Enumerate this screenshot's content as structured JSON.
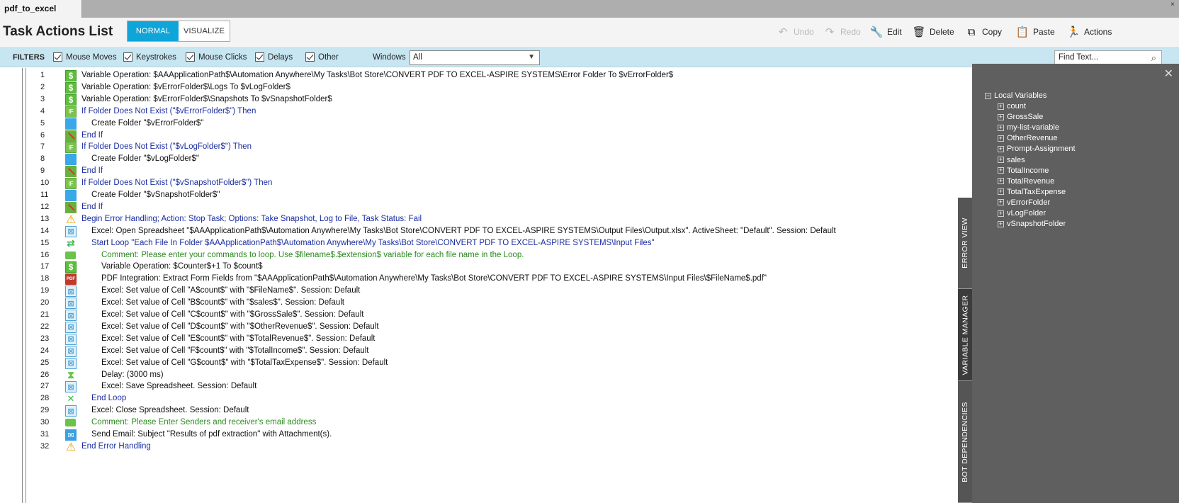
{
  "tab": {
    "label": "pdf_to_excel",
    "close": "×"
  },
  "header": {
    "title": "Task Actions List",
    "modes": {
      "normal": "NORMAL",
      "visualize": "VISUALIZE"
    },
    "toolbar": {
      "undo": "Undo",
      "redo": "Redo",
      "edit": "Edit",
      "delete": "Delete",
      "copy": "Copy",
      "paste": "Paste",
      "actions": "Actions"
    }
  },
  "filters": {
    "label": "FILTERS",
    "items": [
      "Mouse Moves",
      "Keystrokes",
      "Mouse Clicks",
      "Delays",
      "Other"
    ],
    "windows_label": "Windows",
    "windows_value": "All",
    "find_placeholder": "Find Text..."
  },
  "actions": [
    {
      "n": "1",
      "icon": "variable",
      "color": "normal",
      "indent": 0,
      "text": "Variable Operation: $AAApplicationPath$\\Automation Anywhere\\My Tasks\\Bot Store\\CONVERT PDF TO EXCEL-ASPIRE SYSTEMS\\Error Folder To $vErrorFolder$"
    },
    {
      "n": "2",
      "icon": "variable",
      "color": "normal",
      "indent": 0,
      "text": "Variable Operation: $vErrorFolder$\\Logs To $vLogFolder$"
    },
    {
      "n": "3",
      "icon": "variable",
      "color": "normal",
      "indent": 0,
      "text": "Variable Operation: $vErrorFolder$\\Snapshots To $vSnapshotFolder$"
    },
    {
      "n": "4",
      "icon": "if",
      "color": "blue",
      "indent": 0,
      "text": "If Folder Does Not Exist (\"$vErrorFolder$\")  Then"
    },
    {
      "n": "5",
      "icon": "folder",
      "color": "normal",
      "indent": 1,
      "text": "Create Folder \"$vErrorFolder$\""
    },
    {
      "n": "6",
      "icon": "endif",
      "color": "blue",
      "indent": 0,
      "text": "End If"
    },
    {
      "n": "7",
      "icon": "if",
      "color": "blue",
      "indent": 0,
      "text": "If Folder Does Not Exist (\"$vLogFolder$\")  Then"
    },
    {
      "n": "8",
      "icon": "folder",
      "color": "normal",
      "indent": 1,
      "text": "Create Folder \"$vLogFolder$\""
    },
    {
      "n": "9",
      "icon": "endif",
      "color": "blue",
      "indent": 0,
      "text": "End If"
    },
    {
      "n": "10",
      "icon": "if",
      "color": "blue",
      "indent": 0,
      "text": "If Folder Does Not Exist (\"$vSnapshotFolder$\")  Then"
    },
    {
      "n": "11",
      "icon": "folder",
      "color": "normal",
      "indent": 1,
      "text": "Create Folder \"$vSnapshotFolder$\""
    },
    {
      "n": "12",
      "icon": "endif",
      "color": "blue",
      "indent": 0,
      "text": "End If"
    },
    {
      "n": "13",
      "icon": "warning",
      "color": "blue",
      "indent": 0,
      "text": "Begin Error Handling; Action: Stop Task; Options: Take Snapshot, Log to File,  Task Status: Fail"
    },
    {
      "n": "14",
      "icon": "excel",
      "color": "normal",
      "indent": 1,
      "text": "Excel: Open Spreadsheet \"$AAApplicationPath$\\Automation Anywhere\\My Tasks\\Bot Store\\CONVERT PDF TO EXCEL-ASPIRE SYSTEMS\\Output Files\\Output.xlsx\". ActiveSheet: \"Default\". Session: Default"
    },
    {
      "n": "15",
      "icon": "loop",
      "color": "blue",
      "indent": 1,
      "text": "Start Loop \"Each File In Folder $AAApplicationPath$\\Automation Anywhere\\My Tasks\\Bot Store\\CONVERT PDF TO EXCEL-ASPIRE SYSTEMS\\Input Files\""
    },
    {
      "n": "16",
      "icon": "comment",
      "color": "green",
      "indent": 2,
      "text": "Comment: Please enter your commands to loop. Use $filename$.$extension$ variable for each file name in the Loop."
    },
    {
      "n": "17",
      "icon": "variable",
      "color": "normal",
      "indent": 2,
      "text": "Variable Operation: $Counter$+1 To $count$"
    },
    {
      "n": "18",
      "icon": "pdf",
      "color": "normal",
      "indent": 2,
      "text": "PDF Integration: Extract Form Fields from \"$AAApplicationPath$\\Automation Anywhere\\My Tasks\\Bot Store\\CONVERT PDF TO EXCEL-ASPIRE SYSTEMS\\Input Files\\$FileName$.pdf\""
    },
    {
      "n": "19",
      "icon": "excel",
      "color": "normal",
      "indent": 2,
      "text": "Excel: Set value of Cell \"A$count$\" with \"$FileName$\". Session: Default"
    },
    {
      "n": "20",
      "icon": "excel",
      "color": "normal",
      "indent": 2,
      "text": "Excel: Set value of Cell \"B$count$\" with \"$sales$\". Session: Default"
    },
    {
      "n": "21",
      "icon": "excel",
      "color": "normal",
      "indent": 2,
      "text": "Excel: Set value of Cell \"C$count$\" with \"$GrossSale$\". Session: Default"
    },
    {
      "n": "22",
      "icon": "excel",
      "color": "normal",
      "indent": 2,
      "text": "Excel: Set value of Cell \"D$count$\" with \"$OtherRevenue$\". Session: Default"
    },
    {
      "n": "23",
      "icon": "excel",
      "color": "normal",
      "indent": 2,
      "text": "Excel: Set value of Cell \"E$count$\" with \"$TotalRevenue$\". Session: Default"
    },
    {
      "n": "24",
      "icon": "excel",
      "color": "normal",
      "indent": 2,
      "text": "Excel: Set value of Cell \"F$count$\" with \"$TotalIncome$\". Session: Default"
    },
    {
      "n": "25",
      "icon": "excel",
      "color": "normal",
      "indent": 2,
      "text": "Excel: Set value of Cell \"G$count$\" with \"$TotalTaxExpense$\". Session: Default"
    },
    {
      "n": "26",
      "icon": "delay",
      "color": "normal",
      "indent": 2,
      "text": "Delay: (3000 ms)"
    },
    {
      "n": "27",
      "icon": "excel",
      "color": "normal",
      "indent": 2,
      "text": "Excel: Save Spreadsheet. Session: Default"
    },
    {
      "n": "28",
      "icon": "endloop",
      "color": "blue",
      "indent": 1,
      "text": "End Loop"
    },
    {
      "n": "29",
      "icon": "excel",
      "color": "normal",
      "indent": 1,
      "text": "Excel: Close Spreadsheet. Session: Default"
    },
    {
      "n": "30",
      "icon": "comment",
      "color": "green",
      "indent": 1,
      "text": "Comment: Please Enter Senders and receiver's email address"
    },
    {
      "n": "31",
      "icon": "email",
      "color": "normal",
      "indent": 1,
      "text": "Send Email: Subject \"Results of pdf extraction\" with Attachment(s)."
    },
    {
      "n": "32",
      "icon": "warning",
      "color": "blue",
      "indent": 0,
      "text": "End Error Handling"
    }
  ],
  "side_tabs": [
    "ERROR VIEW",
    "VARIABLE MANAGER",
    "BOT DEPENDENCIES"
  ],
  "variables": {
    "root": "Local Variables",
    "items": [
      "count",
      "GrossSale",
      "my-list-variable",
      "OtherRevenue",
      "Prompt-Assignment",
      "sales",
      "TotalIncome",
      "TotalRevenue",
      "TotalTaxExpense",
      "vErrorFolder",
      "vLogFolder",
      "vSnapshotFolder"
    ]
  },
  "colors": {
    "accent": "#0fa5d8",
    "filter_bar": "#c8e6f2",
    "panel": "#5f5f5f",
    "text_blue": "#1b2ea0",
    "text_green": "#2a8a1f"
  }
}
